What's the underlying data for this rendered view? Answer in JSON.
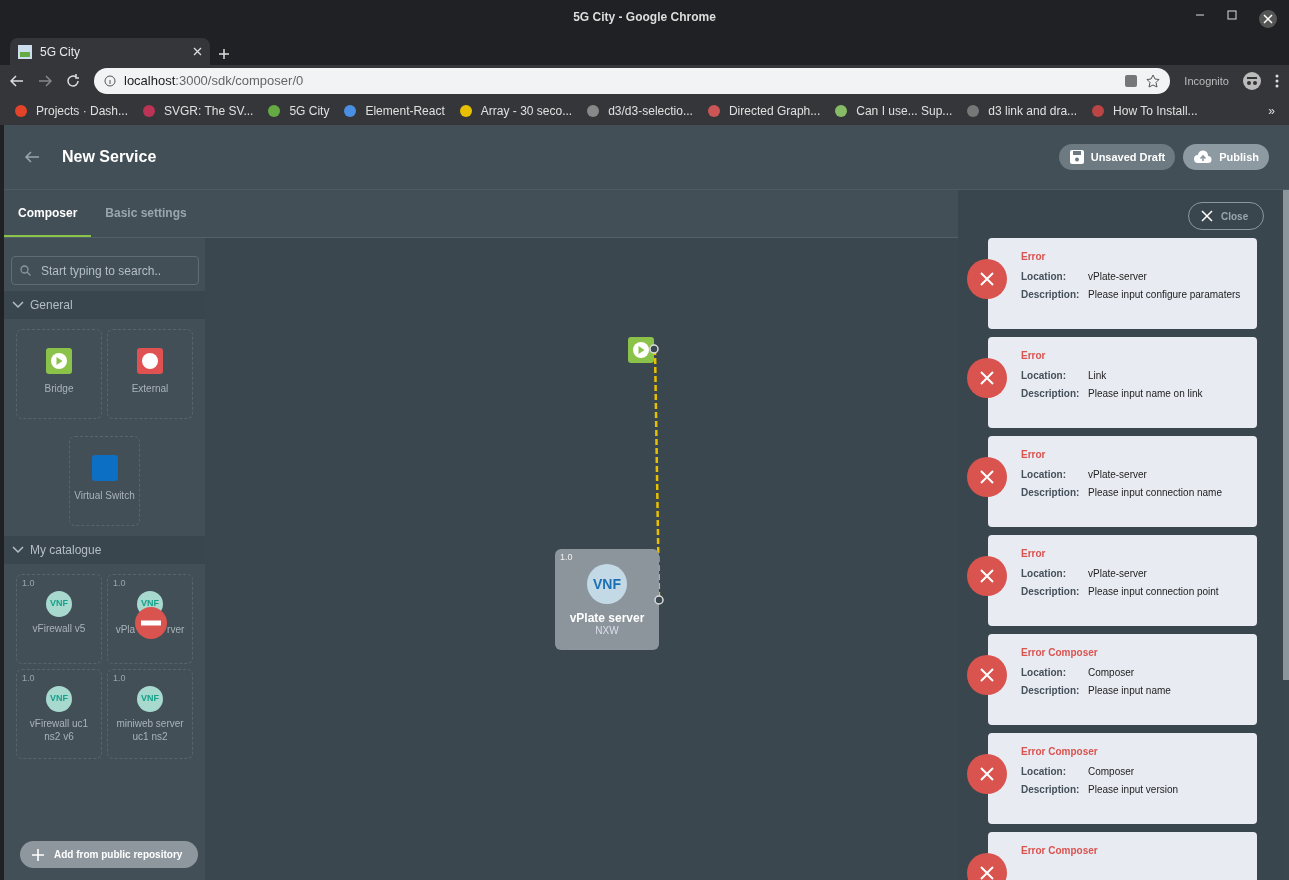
{
  "window": {
    "title": "5G City - Google Chrome"
  },
  "browser": {
    "tab": "5G City",
    "url_host": "localhost",
    "url_path": ":3000/sdk/composer/0",
    "profile": "Incognito",
    "bookmarks": [
      {
        "label": "Projects · Dash..."
      },
      {
        "label": "SVGR: The SV..."
      },
      {
        "label": "5G City"
      },
      {
        "label": "Element-React"
      },
      {
        "label": "Array - 30 seco..."
      },
      {
        "label": "d3/d3-selectio..."
      },
      {
        "label": "Directed Graph..."
      },
      {
        "label": "Can I use... Sup..."
      },
      {
        "label": "d3 link and dra..."
      },
      {
        "label": "How To Install..."
      }
    ],
    "more": "»"
  },
  "header": {
    "title": "New Service",
    "buttons": [
      {
        "kind": "save",
        "label": "Unsaved Draft"
      },
      {
        "kind": "publish",
        "label": "Publish"
      }
    ]
  },
  "tabs": [
    {
      "label": "Composer",
      "selected": true
    },
    {
      "label": "Basic settings",
      "selected": false
    }
  ],
  "sidebar": {
    "search": {
      "placeholder": "Start typing to search.."
    },
    "sections": [
      {
        "title": "General",
        "expanded": true,
        "items": [
          {
            "kind": "bridge",
            "label": "Bridge"
          },
          {
            "kind": "external",
            "label": "External"
          },
          {
            "kind": "switch",
            "label": "Virtual Switch"
          }
        ]
      },
      {
        "title": "My catalogue",
        "expanded": true,
        "items": [
          {
            "kind": "vnf",
            "version": "1.0",
            "icon": "VNF",
            "label": "vFirewall v5"
          },
          {
            "kind": "vnf_blocked",
            "version": "1.0",
            "icon": "VNF",
            "label": "vPla",
            "label_tail": "rver"
          },
          {
            "kind": "vnf",
            "version": "1.0",
            "icon": "VNF",
            "label": "vFirewall uc1 ns2 v6"
          },
          {
            "kind": "vnf",
            "version": "1.0",
            "icon": "VNF",
            "label": "miniweb server uc1 ns2"
          }
        ]
      }
    ],
    "add_button": "Add from public repository"
  },
  "canvas": {
    "node": {
      "version": "1.0",
      "icon": "VNF",
      "name": "vPlate server",
      "vendor": "NXW"
    }
  },
  "errors": {
    "close": "Close",
    "items": [
      {
        "title": "Error",
        "location_label": "Location:",
        "location": "vPlate-server",
        "description_label": "Description:",
        "description": "Please input configure paramaters"
      },
      {
        "title": "Error",
        "location_label": "Location:",
        "location": "Link",
        "description_label": "Description:",
        "description": "Please input name on link"
      },
      {
        "title": "Error",
        "location_label": "Location:",
        "location": "vPlate-server",
        "description_label": "Description:",
        "description": "Please input connection name"
      },
      {
        "title": "Error",
        "location_label": "Location:",
        "location": "vPlate-server",
        "description_label": "Description:",
        "description": "Please input connection point"
      },
      {
        "title": "Error Composer",
        "location_label": "Location:",
        "location": "Composer",
        "description_label": "Description:",
        "description": "Please input name"
      },
      {
        "title": "Error Composer",
        "location_label": "Location:",
        "location": "Composer",
        "description_label": "Description:",
        "description": "Please input version"
      },
      {
        "title": "Error Composer"
      }
    ]
  }
}
